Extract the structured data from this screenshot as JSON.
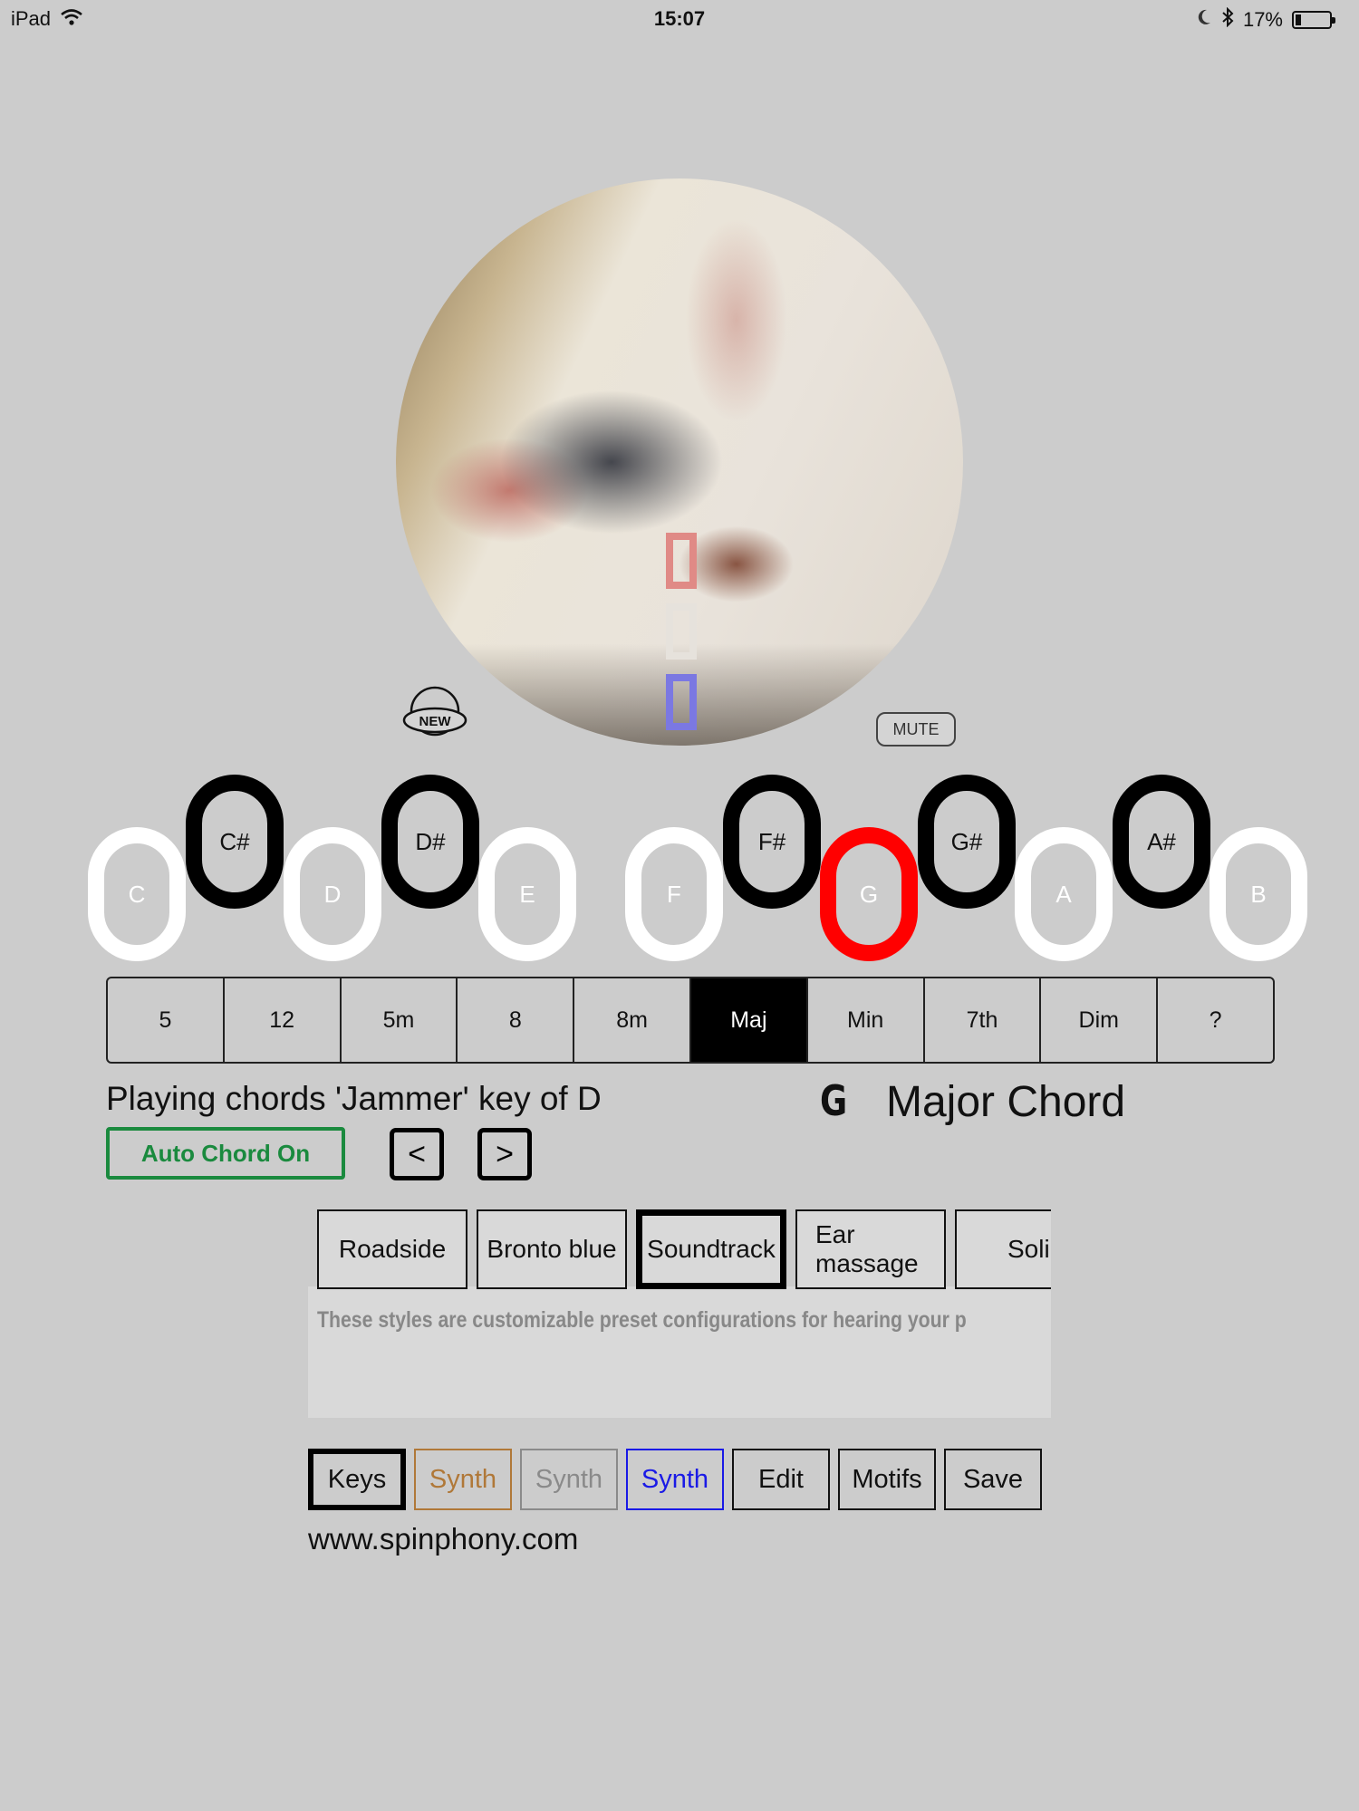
{
  "status_bar": {
    "device": "iPad",
    "time": "15:07",
    "battery": "17%"
  },
  "photo": {
    "new_label": "NEW",
    "mute_label": "MUTE"
  },
  "keys": [
    {
      "label": "C",
      "type": "white"
    },
    {
      "label": "C#",
      "type": "black"
    },
    {
      "label": "D",
      "type": "white"
    },
    {
      "label": "D#",
      "type": "black"
    },
    {
      "label": "E",
      "type": "white"
    },
    {
      "label": "F",
      "type": "white"
    },
    {
      "label": "F#",
      "type": "black"
    },
    {
      "label": "G",
      "type": "active"
    },
    {
      "label": "G#",
      "type": "black"
    },
    {
      "label": "A",
      "type": "white"
    },
    {
      "label": "A#",
      "type": "black"
    },
    {
      "label": "B",
      "type": "white"
    }
  ],
  "chord_types": [
    "5",
    "12",
    "5m",
    "8",
    "8m",
    "Maj",
    "Min",
    "7th",
    "Dim",
    "?"
  ],
  "chord_selected": "Maj",
  "info": {
    "playing": "Playing chords 'Jammer' key of D",
    "chord_letter": "G",
    "chord_name": "Major Chord"
  },
  "controls": {
    "auto_chord": "Auto Chord On",
    "prev": "<",
    "next": ">"
  },
  "styles": {
    "items": [
      "Roadside",
      "Bronto blue",
      "Soundtrack",
      "Ear massage",
      "Soli"
    ],
    "selected": "Soundtrack",
    "description": "These styles are customizable preset configurations for hearing your p"
  },
  "bottom_buttons": [
    {
      "label": "Keys",
      "color": "#000000"
    },
    {
      "label": "Synth",
      "color": "#b07838"
    },
    {
      "label": "Synth",
      "color": "#8a8a8a"
    },
    {
      "label": "Synth",
      "color": "#1a1ae6"
    },
    {
      "label": "Edit",
      "color": "#111111"
    },
    {
      "label": "Motifs",
      "color": "#111111"
    },
    {
      "label": "Save",
      "color": "#111111"
    }
  ],
  "footer": {
    "url": "www.spinphony.com"
  }
}
